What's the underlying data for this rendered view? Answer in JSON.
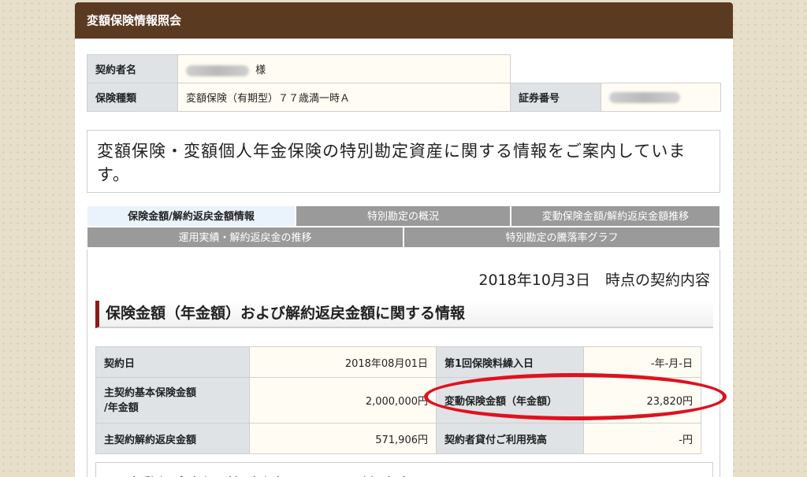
{
  "header": {
    "title": "変額保険情報照会"
  },
  "contract_info": {
    "holder_label": "契約者名",
    "holder_suffix": "様",
    "type_label": "保険種類",
    "type_value": "変額保険（有期型）７７歳満一時Ａ",
    "policy_no_label": "証券番号"
  },
  "notice": {
    "text": "変額保険・変額個人年金保険の特別勘定資産に関する情報をご案内しています。"
  },
  "tabs": {
    "row1": [
      "保険金額/解約返戻金額情報",
      "特別勘定の概況",
      "変動保険金額/解約返戻金額推移"
    ],
    "row2": [
      "運用実績・解約返戻金の推移",
      "特別勘定の騰落率グラフ"
    ]
  },
  "content": {
    "as_of": "2018年10月3日　時点の契約内容",
    "section_title": "保険金額（年金額）および解約返戻金額に関する情報",
    "rows": [
      {
        "label1": "契約日",
        "value1": "2018年08月01日",
        "label2": "第1回保険料繰入日",
        "value2": "-年-月-日"
      },
      {
        "label1": "主契約基本保険金額\n/年金額",
        "value1": "2,000,000円",
        "label2": "変動保険金額（年金額）",
        "value2": "23,820円"
      },
      {
        "label1": "主契約解約返戻金額",
        "value1": "571,906円",
        "label2": "契約者貸付ご利用残高",
        "value2": "-円"
      }
    ],
    "next_section": "＜変動保険金額（年金額）に関するご留意事項＞"
  },
  "colors": {
    "header_bg": "#5b3a22",
    "accent_red": "#e0111f",
    "tab_inactive": "#9a9a9a",
    "tab_active": "#eaf2fb"
  }
}
